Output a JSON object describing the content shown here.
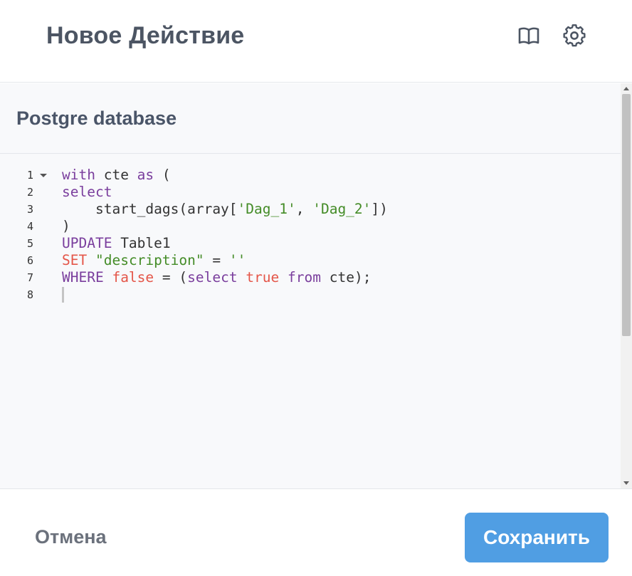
{
  "header": {
    "title": "Новое Действие",
    "icons": [
      "book-icon",
      "gear-icon"
    ]
  },
  "section": {
    "title": "Postgre database"
  },
  "editor": {
    "line_numbers": [
      "1",
      "2",
      "3",
      "4",
      "5",
      "6",
      "7",
      "8"
    ],
    "lines": [
      "with cte as (",
      "select",
      "    start_dags(array['Dag_1', 'Dag_2'])",
      ")",
      "UPDATE Table1",
      "SET \"description\" = ''",
      "WHERE false = (select true from cte);",
      ""
    ]
  },
  "footer": {
    "cancel_label": "Отмена",
    "save_label": "Сохранить"
  },
  "colors": {
    "accent": "#509ee3",
    "keyword": "#7a3e9d",
    "string": "#448c27",
    "constant": "#e45649"
  }
}
